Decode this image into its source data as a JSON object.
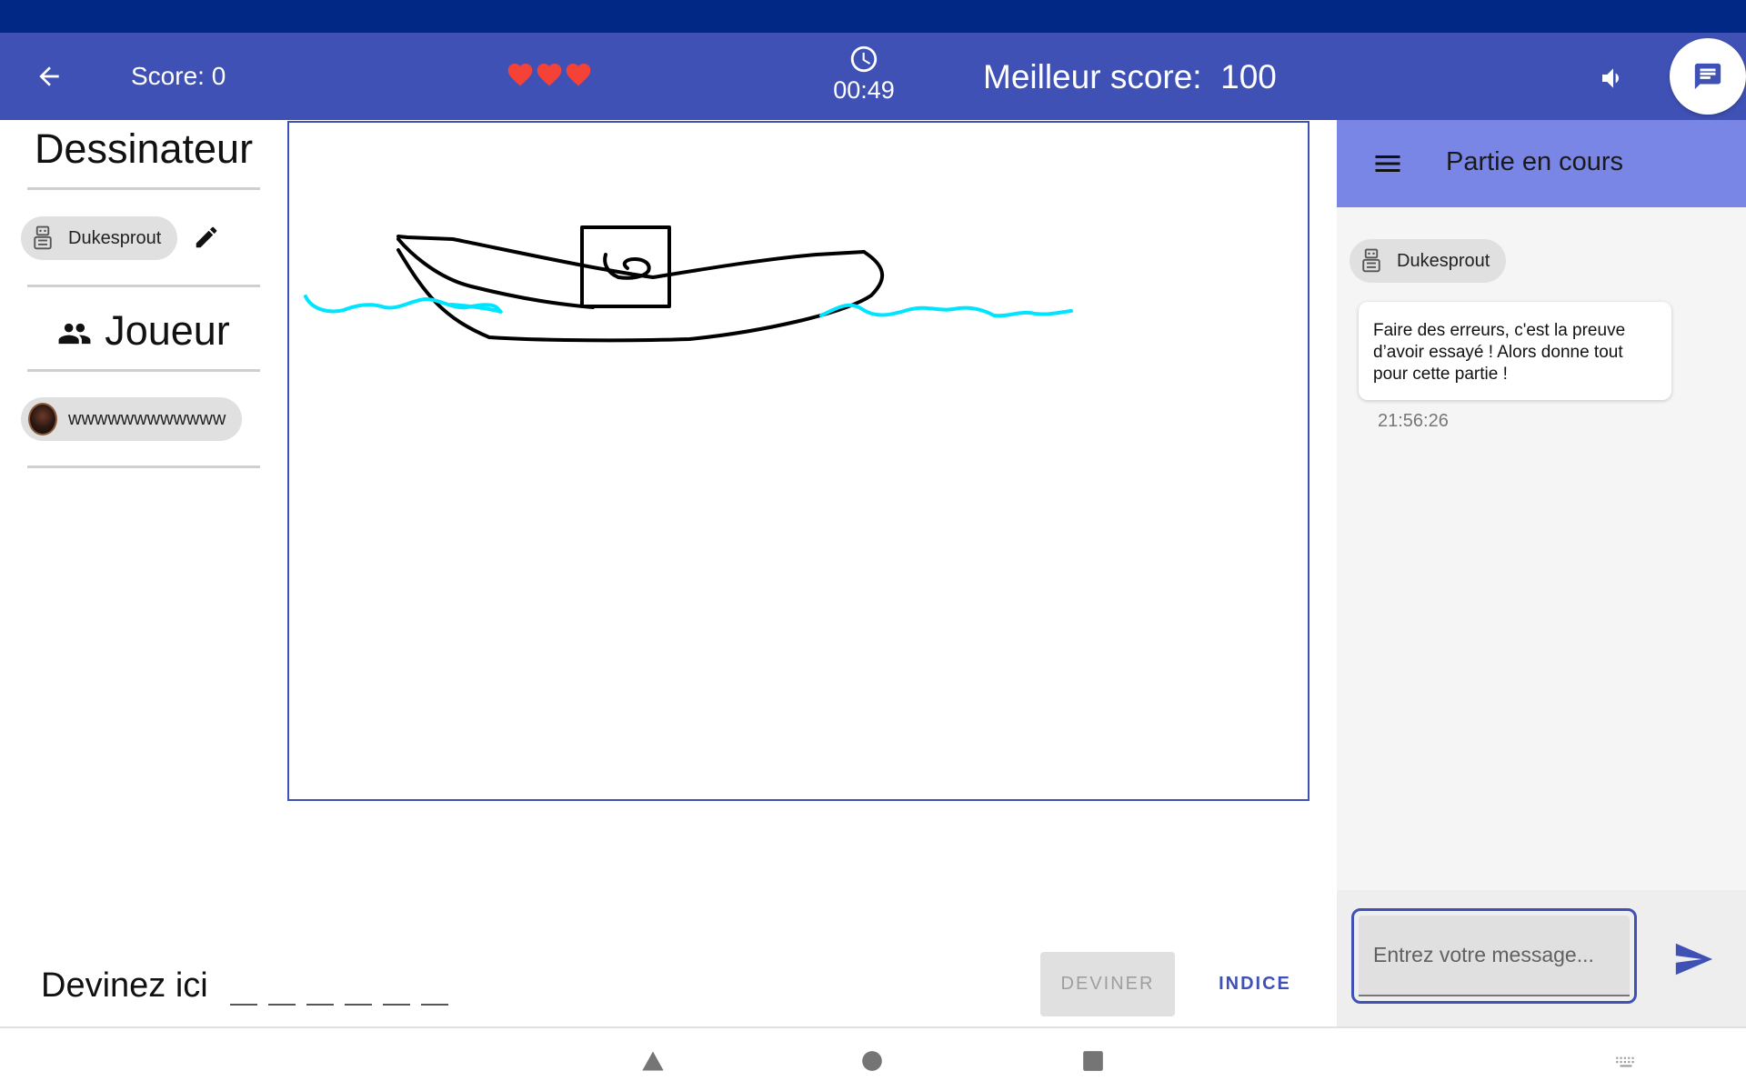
{
  "app_bar": {
    "score_label": "Score: 0",
    "lives": 3,
    "timer": "00:49",
    "best_score_label": "Meilleur score:  100",
    "icons": [
      "arrow-back-icon",
      "heart-icon",
      "clock-icon",
      "volume-icon",
      "chat-icon"
    ]
  },
  "left_panel": {
    "drawer_title": "Dessinateur",
    "drawer_player": "Dukesprout",
    "players_title": "Joueur",
    "player": "wwwwwwwwwwww"
  },
  "guess": {
    "label": "Devinez ici",
    "slots": 6,
    "guess_button": "DEVINER",
    "hint_button": "INDICE"
  },
  "chat": {
    "title": "Partie en cours",
    "sender": "Dukesprout",
    "message": "Faire des erreurs, c'est la preuve d’avoir essayé ! Alors donne tout pour cette partie !",
    "time": "21:56:26",
    "input_placeholder": "Entrez votre message..."
  },
  "colors": {
    "status_bar": "#002884",
    "primary": "#3f51b5",
    "chat_header": "#7986e5",
    "heart": "#f44336",
    "water_stroke": "#00e5ff",
    "drawing_stroke": "#000000"
  }
}
